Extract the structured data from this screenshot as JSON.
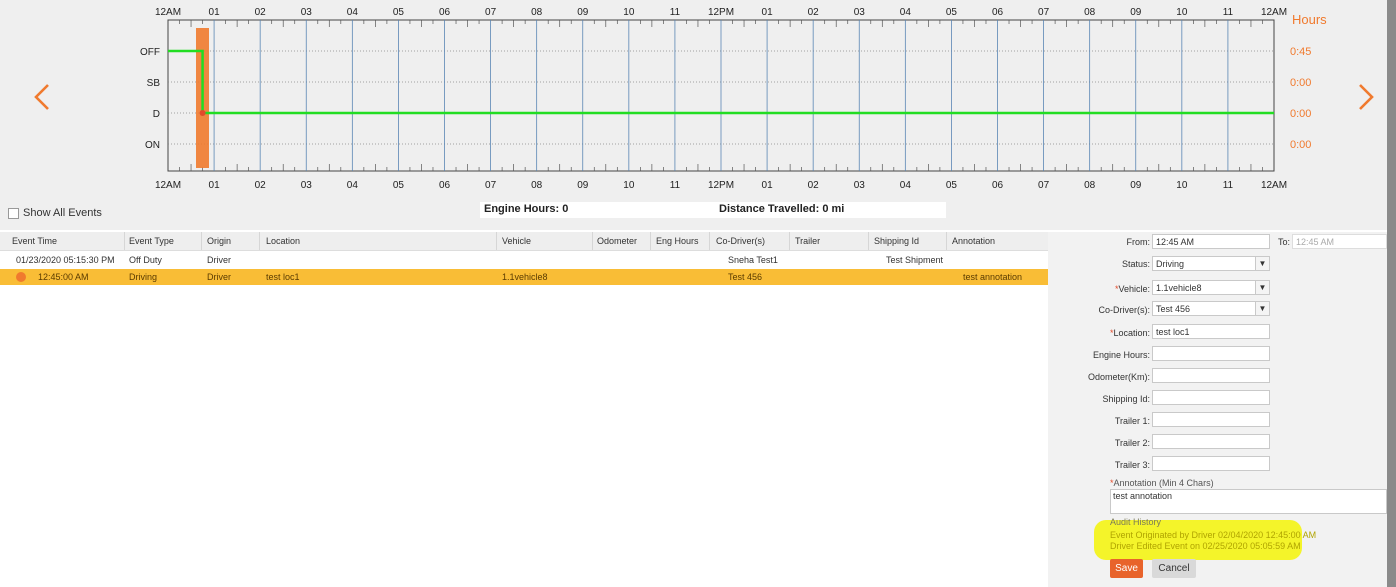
{
  "graph": {
    "hour_labels": [
      "12AM",
      "01",
      "02",
      "03",
      "04",
      "05",
      "06",
      "07",
      "08",
      "09",
      "10",
      "11",
      "12PM",
      "01",
      "02",
      "03",
      "04",
      "05",
      "06",
      "07",
      "08",
      "09",
      "10",
      "11",
      "12AM"
    ],
    "status_labels": [
      "OFF",
      "SB",
      "D",
      "ON"
    ],
    "hours_header": "Hours",
    "status_hours": [
      "0:45",
      "0:00",
      "0:00",
      "0:00"
    ],
    "line_color": "#22dd22",
    "highlight_color": "#f07a2e"
  },
  "nav": {
    "prev_icon": "chevron-left-icon",
    "next_icon": "chevron-right-icon"
  },
  "show_all_events_label": "Show All Events",
  "summary": {
    "engine_hours": "Engine Hours: 0",
    "distance": "Distance Travelled: 0 mi"
  },
  "table": {
    "headers": [
      "Event Time",
      "Event Type",
      "Origin",
      "Location",
      "Vehicle",
      "Odometer",
      "Eng Hours",
      "Co-Driver(s)",
      "Trailer",
      "Shipping Id",
      "Annotation"
    ],
    "rows": [
      {
        "event_time": "01/23/2020 05:15:30 PM",
        "event_type": "Off Duty",
        "origin": "Driver",
        "location": "",
        "vehicle": "",
        "odometer": "",
        "eng_hours": "",
        "co_driver": "Sneha Test1",
        "trailer": "",
        "shipping_id": "Test Shipment",
        "annotation": ""
      },
      {
        "event_time": "12:45:00 AM",
        "event_type": "Driving",
        "origin": "Driver",
        "location": "test loc1",
        "vehicle": "1.1vehicle8",
        "odometer": "",
        "eng_hours": "",
        "co_driver": "Test 456",
        "trailer": "",
        "shipping_id": "",
        "annotation": "test annotation"
      }
    ]
  },
  "form": {
    "from_label": "From:",
    "from_value": "12:45 AM",
    "to_label": "To:",
    "to_placeholder": "12:45 AM",
    "status_label": "Status:",
    "status_value": "Driving",
    "vehicle_label": "Vehicle:",
    "vehicle_value": "1.1vehicle8",
    "codriver_label": "Co-Driver(s):",
    "codriver_value": "Test 456",
    "location_label": "Location:",
    "location_value": "test loc1",
    "engine_hours_label": "Engine Hours:",
    "engine_hours_value": "",
    "odometer_label": "Odometer(Km):",
    "odometer_value": "",
    "shipping_label": "Shipping Id:",
    "shipping_value": "",
    "trailer1_label": "Trailer 1:",
    "trailer1_value": "",
    "trailer2_label": "Trailer 2:",
    "trailer2_value": "",
    "trailer3_label": "Trailer 3:",
    "trailer3_value": "",
    "annotation_label": "Annotation (Min 4 Chars)",
    "annotation_value": "test annotation",
    "required_mark": "*"
  },
  "audit": {
    "title": "Audit History",
    "lines": [
      "Event Originated by Driver 02/04/2020 12:45:00 AM",
      "Driver Edited Event on 02/25/2020 05:05:59 AM"
    ]
  },
  "buttons": {
    "save": "Save",
    "cancel": "Cancel"
  },
  "colors": {
    "accent": "#f07a2e",
    "selected_row": "#f9bd36",
    "save_button": "#e8632b",
    "audit_highlight": "#f4f42a"
  }
}
